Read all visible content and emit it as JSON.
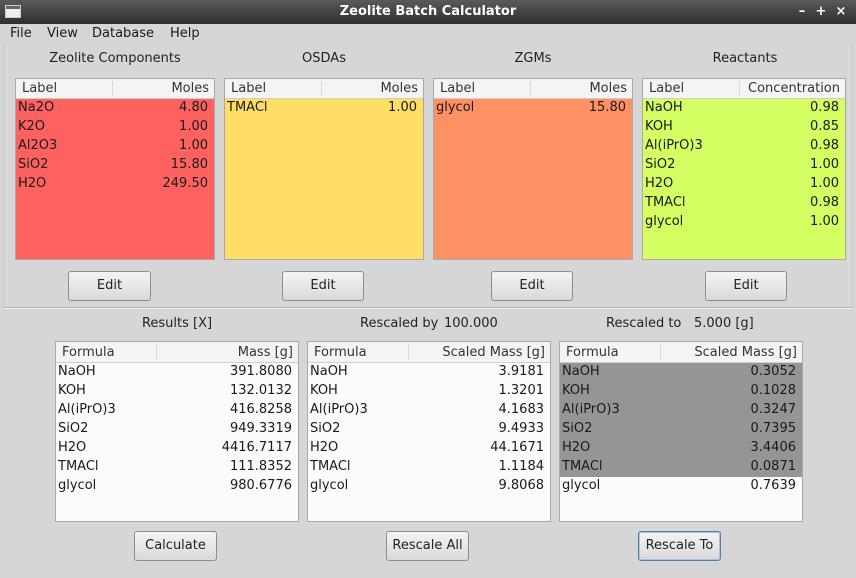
{
  "window": {
    "title": "Zeolite Batch Calculator"
  },
  "menu": [
    "File",
    "View",
    "Database",
    "Help"
  ],
  "colors": {
    "zeolite": "#fd6261",
    "osda": "#fede65",
    "zgm": "#fe9163",
    "reactants": "#d5fe63",
    "selected": "#959595"
  },
  "zeolite": {
    "title": "Zeolite Components",
    "headers": [
      "Label",
      "Moles"
    ],
    "rows": [
      [
        "Na2O",
        "4.80"
      ],
      [
        "K2O",
        "1.00"
      ],
      [
        "Al2O3",
        "1.00"
      ],
      [
        "SiO2",
        "15.80"
      ],
      [
        "H2O",
        "249.50"
      ]
    ],
    "edit": "Edit"
  },
  "osda": {
    "title": "OSDAs",
    "headers": [
      "Label",
      "Moles"
    ],
    "rows": [
      [
        "TMACl",
        "1.00"
      ]
    ],
    "edit": "Edit"
  },
  "zgm": {
    "title": "ZGMs",
    "headers": [
      "Label",
      "Moles"
    ],
    "rows": [
      [
        "glycol",
        "15.80"
      ]
    ],
    "edit": "Edit"
  },
  "reactants": {
    "title": "Reactants",
    "headers": [
      "Label",
      "Concentration"
    ],
    "rows": [
      [
        "NaOH",
        "0.98"
      ],
      [
        "KOH",
        "0.85"
      ],
      [
        "Al(iPrO)3",
        "0.98"
      ],
      [
        "SiO2",
        "1.00"
      ],
      [
        "H2O",
        "1.00"
      ],
      [
        "TMACl",
        "0.98"
      ],
      [
        "glycol",
        "1.00"
      ]
    ],
    "edit": "Edit"
  },
  "results": {
    "title": "Results [X]",
    "headers": [
      "Formula",
      "Mass [g]"
    ],
    "rows": [
      [
        "NaOH",
        "391.8080"
      ],
      [
        "KOH",
        "132.0132"
      ],
      [
        "Al(iPrO)3",
        "416.8258"
      ],
      [
        "SiO2",
        "949.3319"
      ],
      [
        "H2O",
        "4416.7117"
      ],
      [
        "TMACl",
        "111.8352"
      ],
      [
        "glycol",
        "980.6776"
      ]
    ],
    "button": "Calculate"
  },
  "rescaled_by": {
    "title": "Rescaled by",
    "factor": "100.000",
    "headers": [
      "Formula",
      "Scaled Mass [g]"
    ],
    "rows": [
      [
        "NaOH",
        "3.9181"
      ],
      [
        "KOH",
        "1.3201"
      ],
      [
        "Al(iPrO)3",
        "4.1683"
      ],
      [
        "SiO2",
        "9.4933"
      ],
      [
        "H2O",
        "44.1671"
      ],
      [
        "TMACl",
        "1.1184"
      ],
      [
        "glycol",
        "9.8068"
      ]
    ],
    "button": "Rescale All"
  },
  "rescaled_to": {
    "title": "Rescaled to",
    "target": "5.000 [g]",
    "headers": [
      "Formula",
      "Scaled Mass [g]"
    ],
    "rows": [
      [
        "NaOH",
        "0.3052"
      ],
      [
        "KOH",
        "0.1028"
      ],
      [
        "Al(iPrO)3",
        "0.3247"
      ],
      [
        "SiO2",
        "0.7395"
      ],
      [
        "H2O",
        "3.4406"
      ],
      [
        "TMACl",
        "0.0871"
      ],
      [
        "glycol",
        "0.7639"
      ]
    ],
    "selected_rows": 6,
    "button": "Rescale To"
  }
}
